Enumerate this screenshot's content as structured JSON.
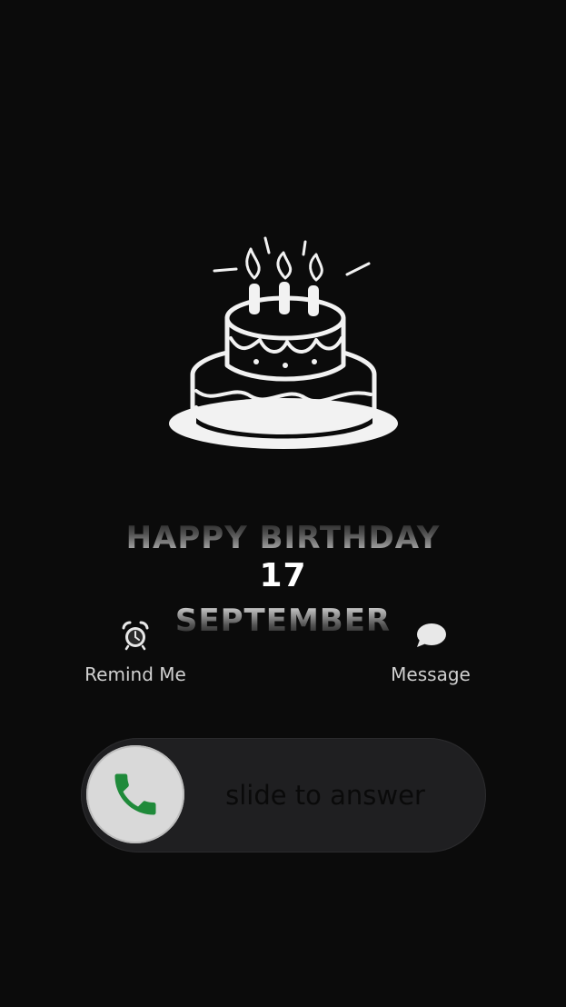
{
  "greeting": {
    "line1": "HAPPY BIRTHDAY",
    "line2": "17",
    "line3": "SEPTEMBER"
  },
  "actions": {
    "remind": {
      "label": "Remind Me",
      "icon": "alarm-clock-icon"
    },
    "message": {
      "label": "Message",
      "icon": "speech-bubble-icon"
    }
  },
  "slider": {
    "label": "slide to answer",
    "icon": "phone-icon",
    "icon_color": "#1f8a3a"
  },
  "colors": {
    "background": "#0b0b0b",
    "slider_track": "#1f1f21",
    "knob": "#d9d9d9"
  }
}
